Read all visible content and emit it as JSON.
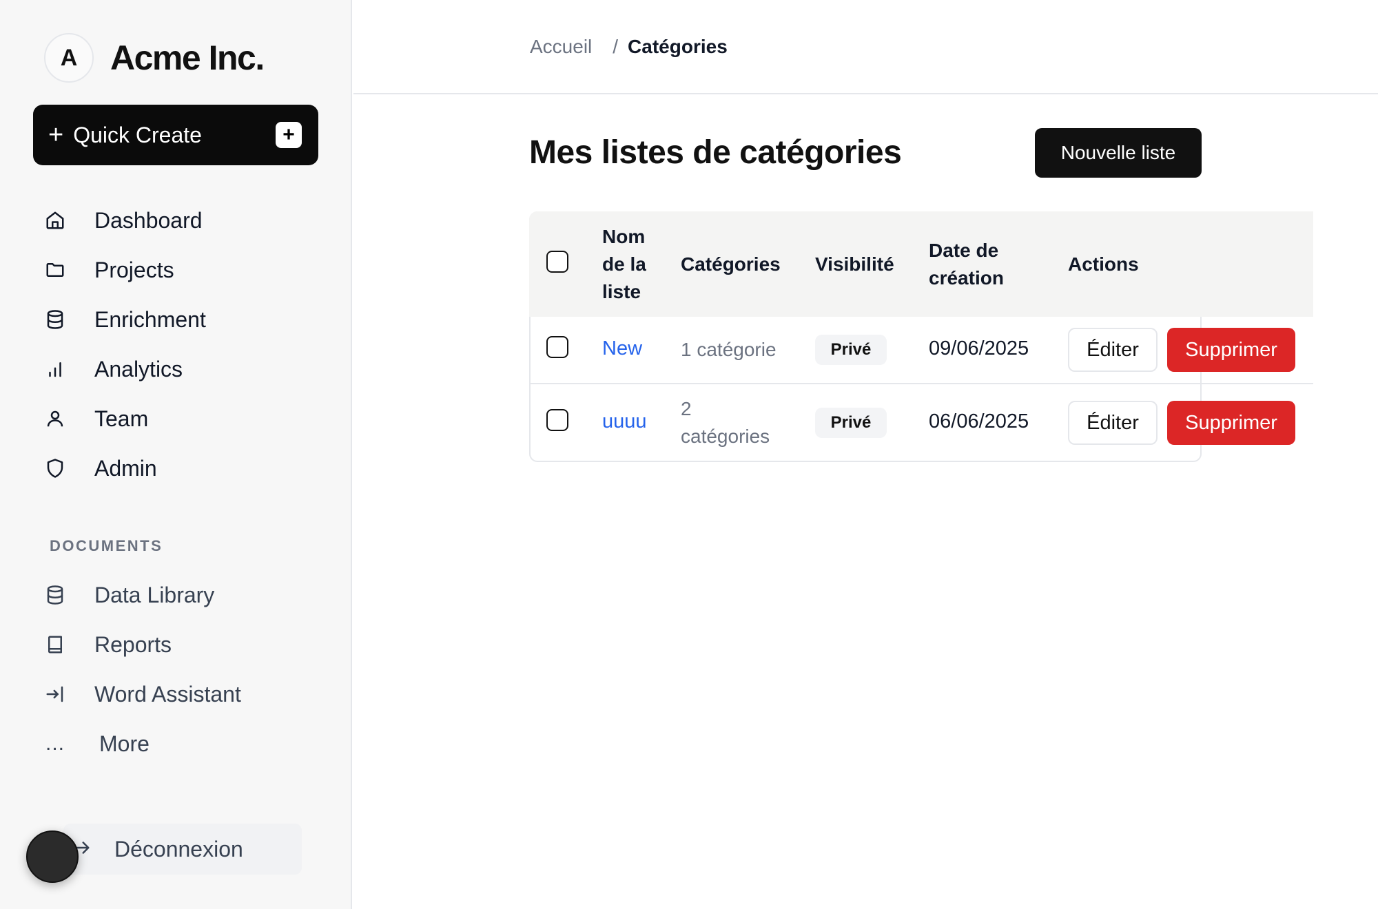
{
  "brand": {
    "avatar_letter": "A",
    "name": "Acme Inc."
  },
  "quick_create": {
    "label": "Quick Create",
    "plus": "+",
    "mini_plus": "+"
  },
  "nav": {
    "items": [
      {
        "label": "Dashboard",
        "icon": "home-icon"
      },
      {
        "label": "Projects",
        "icon": "folder-icon"
      },
      {
        "label": "Enrichment",
        "icon": "database-icon"
      },
      {
        "label": "Analytics",
        "icon": "bar-chart-icon"
      },
      {
        "label": "Team",
        "icon": "user-icon"
      },
      {
        "label": "Admin",
        "icon": "shield-icon"
      }
    ]
  },
  "documents": {
    "section_label": "DOCUMENTS",
    "items": [
      {
        "label": "Data Library",
        "icon": "database-icon"
      },
      {
        "label": "Reports",
        "icon": "book-icon"
      },
      {
        "label": "Word Assistant",
        "icon": "login-icon"
      }
    ],
    "more_label": "More",
    "more_icon": "..."
  },
  "logout": {
    "label": "Déconnexion",
    "icon": "logout-icon"
  },
  "breadcrumb": {
    "home": "Accueil",
    "separator": "/",
    "current": "Catégories"
  },
  "page": {
    "title": "Mes listes de catégories",
    "new_button": "Nouvelle liste"
  },
  "table": {
    "headers": {
      "name": [
        "Nom",
        "de la",
        "liste"
      ],
      "categories": "Catégories",
      "visibility": "Visibilité",
      "date": [
        "Date de",
        "création"
      ],
      "actions": "Actions"
    },
    "rows": [
      {
        "name": "New",
        "categories": [
          "1 catégorie"
        ],
        "visibility": "Privé",
        "date": "09/06/2025",
        "edit": "Éditer",
        "delete": "Supprimer"
      },
      {
        "name": "uuuu",
        "categories": [
          "2",
          "catégories"
        ],
        "visibility": "Privé",
        "date": "06/06/2025",
        "edit": "Éditer",
        "delete": "Supprimer"
      }
    ]
  },
  "colors": {
    "accent_link": "#2563eb",
    "danger": "#dc2626",
    "primary": "#111111"
  }
}
